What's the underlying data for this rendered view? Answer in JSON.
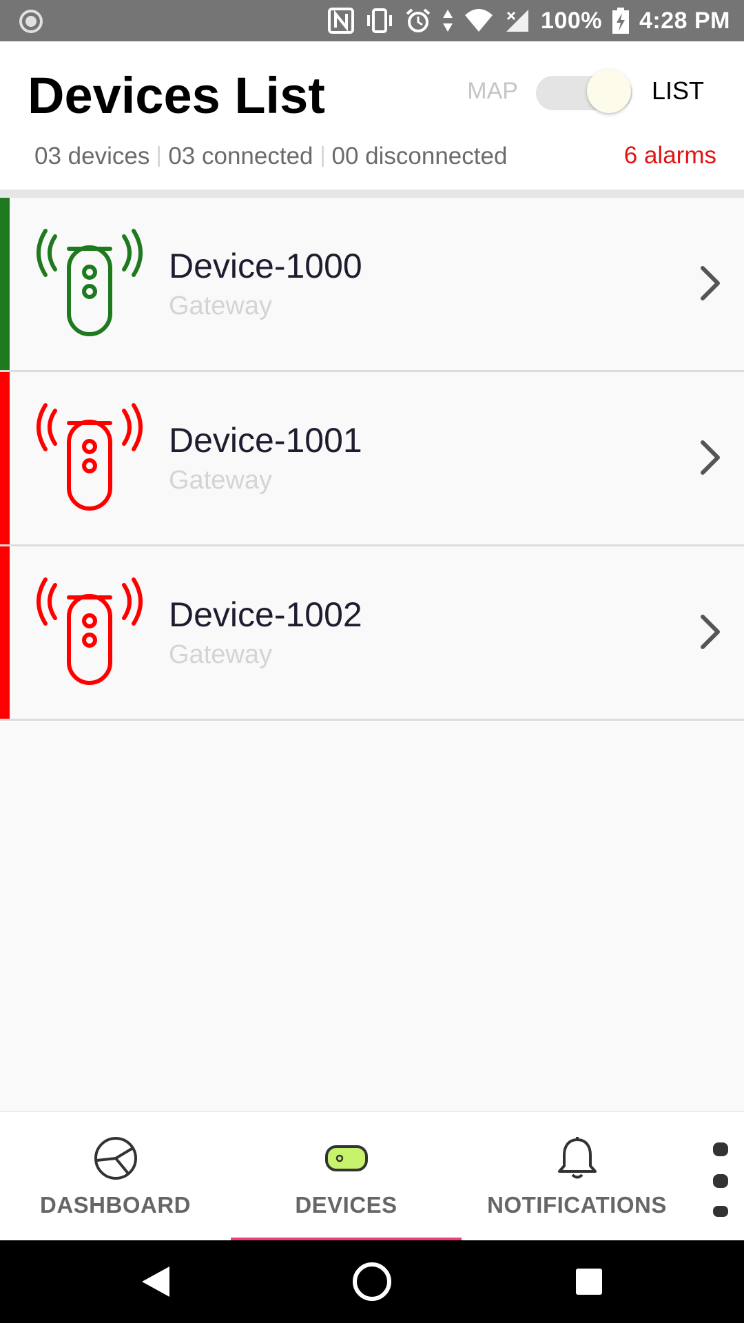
{
  "status_bar": {
    "battery": "100%",
    "time": "4:28 PM",
    "icons": [
      "record-icon",
      "nfc-icon",
      "vibrate-icon",
      "alarm-icon",
      "data-arrows-icon",
      "wifi-icon",
      "signal-icon",
      "battery-charging-icon"
    ]
  },
  "header": {
    "title": "Devices List",
    "view_toggle": {
      "map_label": "MAP",
      "list_label": "LIST",
      "selected": "LIST"
    },
    "summary": {
      "devices": "03 devices",
      "connected": "03 connected",
      "disconnected": "00 disconnected",
      "alarms": "6 alarms"
    }
  },
  "devices": [
    {
      "name": "Device-1000",
      "type": "Gateway",
      "status_color": "#1f7a1f",
      "icon": "gateway-icon"
    },
    {
      "name": "Device-1001",
      "type": "Gateway",
      "status_color": "#ff0000",
      "icon": "gateway-icon"
    },
    {
      "name": "Device-1002",
      "type": "Gateway",
      "status_color": "#ff0000",
      "icon": "gateway-icon"
    }
  ],
  "bottom_nav": {
    "items": [
      {
        "label": "DASHBOARD",
        "icon": "pie-chart-icon"
      },
      {
        "label": "DEVICES",
        "icon": "device-icon",
        "selected": true
      },
      {
        "label": "NOTIFICATIONS",
        "icon": "bell-icon"
      }
    ],
    "accent": "#ec3f7b",
    "more_icon": "more-vertical-icon"
  },
  "colors": {
    "alarm": "#e41212",
    "connected": "#1f7a1f",
    "alarmed": "#ff0000"
  }
}
